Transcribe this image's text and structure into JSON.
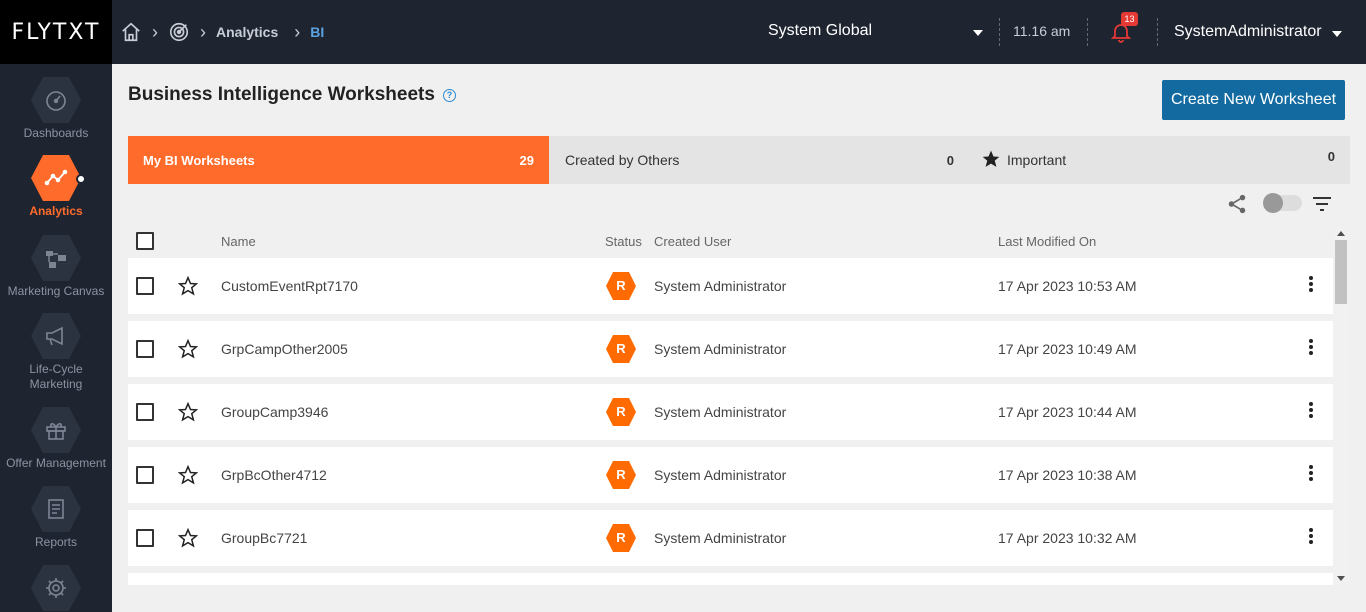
{
  "brand": {
    "logo_text": "FLYTXT"
  },
  "header": {
    "breadcrumbs": {
      "analytics": "Analytics",
      "current": "BI"
    },
    "scope": "System Global",
    "time": "11.16 am",
    "notifications_count": "13",
    "user": "SystemAdministrator"
  },
  "sidebar": {
    "items": [
      {
        "label": "Dashboards",
        "icon": "gauge-icon"
      },
      {
        "label": "Analytics",
        "icon": "analytics-icon",
        "active": true
      },
      {
        "label": "Marketing Canvas",
        "icon": "canvas-icon"
      },
      {
        "label": "Life-Cycle Marketing",
        "icon": "megaphone-icon"
      },
      {
        "label": "Offer Management",
        "icon": "gift-icon"
      },
      {
        "label": "Reports",
        "icon": "report-icon"
      },
      {
        "label": "",
        "icon": "settings-icon"
      }
    ]
  },
  "page": {
    "title": "Business Intelligence Worksheets",
    "create_button": "Create New Worksheet"
  },
  "tabs": [
    {
      "label": "My BI Worksheets",
      "count": "29"
    },
    {
      "label": "Created by Others",
      "count": "0"
    },
    {
      "label": "Important",
      "count": "0"
    }
  ],
  "table": {
    "headers": {
      "name": "Name",
      "status": "Status",
      "created_user": "Created User",
      "modified": "Last Modified On"
    },
    "rows": [
      {
        "name": "CustomEventRpt7170",
        "status": "R",
        "created_user": "System Administrator",
        "modified": "17 Apr 2023 10:53 AM"
      },
      {
        "name": "GrpCampOther2005",
        "status": "R",
        "created_user": "System Administrator",
        "modified": "17 Apr 2023 10:49 AM"
      },
      {
        "name": "GroupCamp3946",
        "status": "R",
        "created_user": "System Administrator",
        "modified": "17 Apr 2023 10:44 AM"
      },
      {
        "name": "GrpBcOther4712",
        "status": "R",
        "created_user": "System Administrator",
        "modified": "17 Apr 2023 10:38 AM"
      },
      {
        "name": "GroupBc7721",
        "status": "R",
        "created_user": "System Administrator",
        "modified": "17 Apr 2023 10:32 AM"
      }
    ]
  },
  "colors": {
    "accent": "#ff6b2b",
    "nav_bg": "#1e2430",
    "primary_button": "#136aa0",
    "link": "#5aa2e0"
  }
}
